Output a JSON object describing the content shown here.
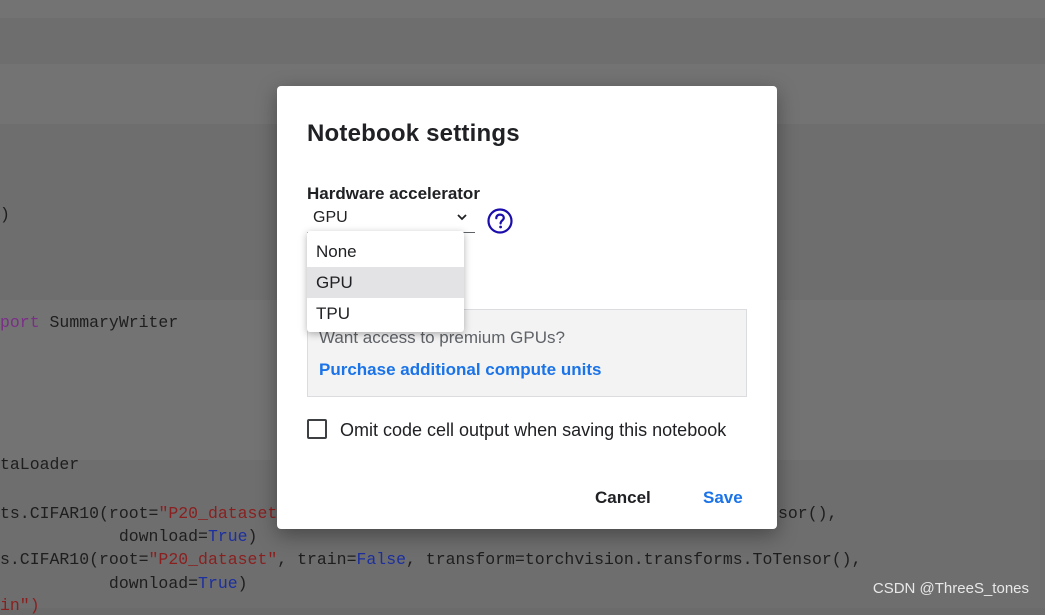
{
  "background_code": {
    "line1": ")",
    "line2_kw": "port",
    "line2_rest": " SummaryWriter",
    "line3": "taLoader",
    "line4_pre": "ts.CIFAR10(root=",
    "line4_str": "\"P20_dataset\"",
    "line5_pre": "            download=",
    "line5_val": "True",
    "line5_post": ")",
    "line6_pre": "s.CIFAR10(root=",
    "line6_str": "\"P20_dataset\"",
    "line6_mid": ", train=",
    "line6_val": "False",
    "line6_post": ", transform=torchvision.transforms.ToTensor(),",
    "line7_pre": "           download=",
    "line7_val": "True",
    "line7_post": ")",
    "line8": "in\")",
    "right_fragment": "sor(),"
  },
  "dialog": {
    "title": "Notebook settings",
    "hardware_label": "Hardware accelerator",
    "selected_value": "GPU",
    "options": [
      "None",
      "GPU",
      "TPU"
    ],
    "premium_text": "Want access to premium GPUs?",
    "premium_link": "Purchase additional compute units",
    "omit_checkbox_label": "Omit code cell output when saving this notebook",
    "omit_checked": false,
    "cancel_label": "Cancel",
    "save_label": "Save"
  },
  "colors": {
    "accent": "#1a73e8",
    "help_icon": "#1a0dab"
  },
  "watermark": "CSDN @ThreeS_tones"
}
